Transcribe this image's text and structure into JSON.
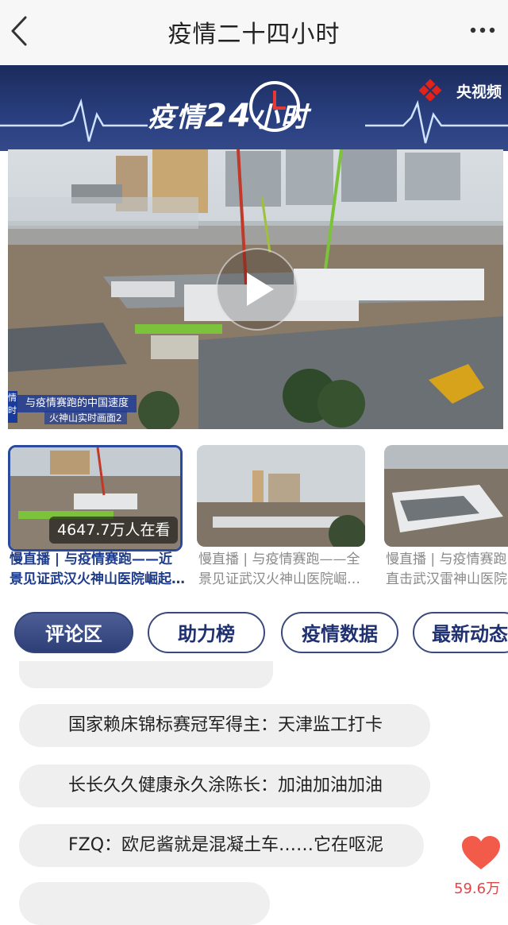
{
  "header": {
    "title": "疫情二十四小时"
  },
  "banner": {
    "title_part1": "疫情",
    "title_big": "24",
    "title_part2": "小时",
    "brand": "央视频"
  },
  "video": {
    "caption_line1": "与疫情赛跑的中国速度",
    "caption_line2": "火神山实时画面2",
    "side_text": "情时"
  },
  "thumbnails": [
    {
      "views": "4647.7万人在看",
      "caption": "慢直播 | 与疫情赛跑——近景见证武汉火神山医院崛起…"
    },
    {
      "caption": "慢直播 | 与疫情赛跑——全景见证武汉火神山医院崛…"
    },
    {
      "caption": "慢直播 | 与疫情赛跑 直击武汉雷神山医院"
    }
  ],
  "tabs": [
    "评论区",
    "助力榜",
    "疫情数据",
    "最新动态"
  ],
  "comments": [
    "国家赖床锦标赛冠军得主：天津监工打卡",
    "长长久久健康永久涂陈长：加油加油加油",
    "FZQ：欧尼酱就是混凝土车……它在呕泥"
  ],
  "likes": "59.6万",
  "colors": {
    "accent": "#2e3f78",
    "like": "#e04646",
    "banner": "#283d7c"
  }
}
